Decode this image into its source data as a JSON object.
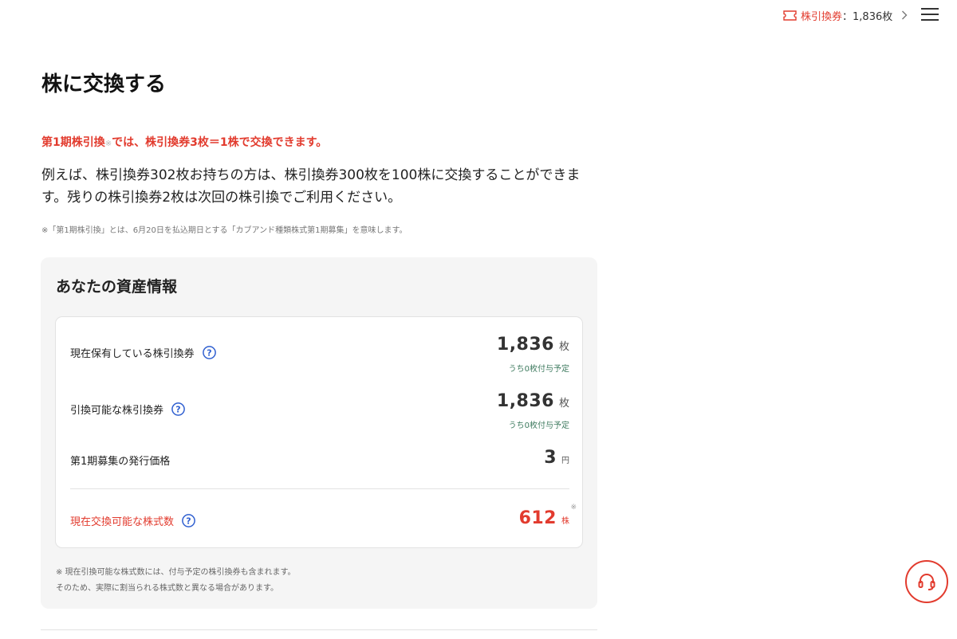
{
  "header": {
    "ticket_label": "株引換券",
    "ticket_colon": "：",
    "ticket_count": "1,836枚",
    "ticket_icon": "ticket-icon",
    "chevron_icon": "chevron-right-icon",
    "menu_icon": "hamburger-menu-icon"
  },
  "page": {
    "title": "株に交換する",
    "lead_part1": "第1期株引換",
    "lead_mark": "※",
    "lead_part2": "では、株引換券3枚＝1株で交換できます。",
    "description": "例えば、株引換券302枚お持ちの方は、株引換券300枚を100株に交換することができます。残りの株引換券2枚は次回の株引換でご利用ください。",
    "footnote": "※「第1期株引換」とは、6月20日を払込期日とする「カブアンド種類株式第1期募集」を意味します。"
  },
  "assets": {
    "title": "あなたの資産情報",
    "rows": [
      {
        "label": "現在保有している株引換券",
        "value": "1,836",
        "unit": "枚",
        "note": "うち0枚付与予定"
      },
      {
        "label": "引換可能な株引換券",
        "value": "1,836",
        "unit": "枚",
        "note": "うち0枚付与予定"
      },
      {
        "label": "第1期募集の発行価格",
        "value": "3",
        "unit": "円"
      }
    ],
    "exchangeable": {
      "label": "現在交換可能な株式数",
      "value": "612",
      "unit": "株",
      "mark": "※"
    },
    "note_line1": "※ 現在引換可能な株式数には、付与予定の株引換券も含まれます。",
    "note_line2": "そのため、実際に割当られる株式数と異なる場合があります。"
  },
  "support": {
    "icon": "headset-icon"
  },
  "colors": {
    "accent": "#e23b2e",
    "panel_bg": "#f5f5f5",
    "help_blue": "#2f5fd0",
    "note_green": "#3d7a5e"
  }
}
